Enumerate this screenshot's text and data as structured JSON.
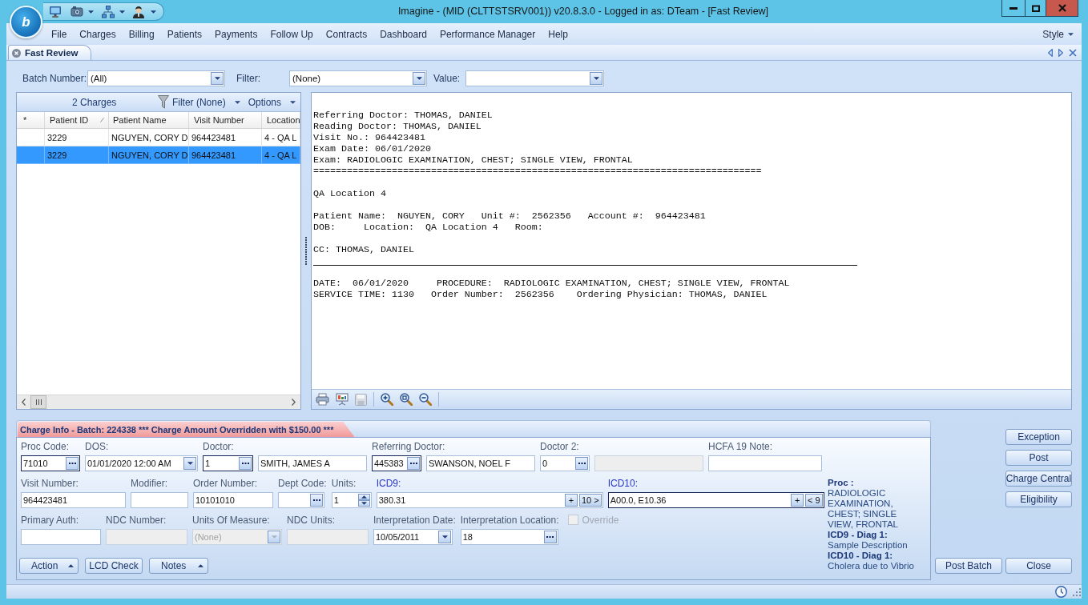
{
  "window": {
    "app_button": "b",
    "title": "Imagine - (MID (CLTTSTSRV001)) v20.8.3.0 - Logged in as: DTeam - [Fast Review]"
  },
  "menu": {
    "items": [
      "File",
      "Charges",
      "Billing",
      "Patients",
      "Payments",
      "Follow Up",
      "Contracts",
      "Dashboard",
      "Performance Manager",
      "Help"
    ],
    "style": "Style"
  },
  "tabs": [
    {
      "label": "Fast Review",
      "selected": true
    }
  ],
  "filters": [
    {
      "label": "Batch Number:",
      "value": "(All)"
    },
    {
      "label": "Filter:",
      "value": "(None)"
    },
    {
      "label": "Value:"
    }
  ],
  "charges_grid": {
    "count": "2 Charges",
    "filter": "Filter (None)",
    "options": "Options",
    "columns": [
      {
        "label": "*",
        "sorted": false
      },
      {
        "label": "Patient ID",
        "sorted": true
      },
      {
        "label": "Patient Name",
        "sorted": false
      },
      {
        "label": "Visit Number",
        "sorted": false
      },
      {
        "label": "Location",
        "sorted": false
      }
    ],
    "rows": [
      {
        "selected": false,
        "cells": [
          "",
          "3229",
          "NGUYEN, CORY D",
          "964423481",
          "4 - QA L"
        ]
      },
      {
        "selected": true,
        "cells": [
          "",
          "3229",
          "NGUYEN, CORY D",
          "964423481",
          "4 - QA L"
        ]
      }
    ]
  },
  "document": {
    "blocks": [
      {
        "kind": "text",
        "lines": [
          "Referring Doctor: THOMAS, DANIEL",
          "Reading Doctor: THOMAS, DANIEL",
          "Visit No.: 964423481",
          "Exam Date: 06/01/2020",
          "Exam: RADIOLOGIC EXAMINATION, CHEST; SINGLE VIEW, FRONTAL",
          "================================================================================"
        ]
      },
      {
        "kind": "text",
        "lines": [
          "QA Location 4"
        ]
      },
      {
        "kind": "text",
        "lines": [
          "Patient Name:  NGUYEN, CORY   Unit #:  2562356   Account #:  964423481",
          "DOB:     Location:  QA Location 4   Room:"
        ]
      },
      {
        "kind": "text",
        "lines": [
          "CC: THOMAS, DANIEL"
        ]
      },
      {
        "kind": "rule"
      },
      {
        "kind": "text",
        "lines": [
          "DATE:  06/01/2020     PROCEDURE:  RADIOLOGIC EXAMINATION, CHEST; SINGLE VIEW, FRONTAL",
          "SERVICE TIME: 1130   Order Number:  2562356    Ordering Physician: THOMAS, DANIEL"
        ]
      }
    ]
  },
  "charge_info": {
    "title": "Charge Info - Batch: 224338 *** Charge Amount Overridden with $150.00 ***",
    "warning": true,
    "rows": [
      {
        "fields": [
          {
            "label": "Proc Code:",
            "kind": "lookup",
            "value": "71010",
            "required": true,
            "disabled": false
          },
          {
            "label": "DOS:",
            "kind": "combo",
            "value": "01/01/2020 12:00 AM",
            "required": false,
            "disabled": false
          },
          {
            "label": "Doctor:",
            "kind": "lookup",
            "value": "1",
            "required": true,
            "disabled": false,
            "description": {
              "value": "SMITH, JAMES A",
              "disabled": false
            }
          },
          {
            "label": "Referring Doctor:",
            "kind": "lookup",
            "value": "445383",
            "required": true,
            "disabled": false,
            "description": {
              "value": "SWANSON, NOEL F",
              "disabled": false
            }
          },
          {
            "label": "Doctor 2:",
            "kind": "lookup",
            "value": "0",
            "required": false,
            "disabled": false,
            "description": {
              "disabled": true
            }
          },
          {
            "label": "HCFA 19 Note:",
            "kind": "text",
            "required": false,
            "disabled": false
          }
        ]
      },
      {
        "fields": [
          {
            "label": "Visit Number:",
            "kind": "text",
            "value": "964423481",
            "required": false,
            "disabled": false
          },
          {
            "label": "Modifier:",
            "kind": "text",
            "required": false,
            "disabled": false
          },
          {
            "label": "Order Number:",
            "kind": "text",
            "value": "10101010",
            "required": false,
            "disabled": false
          },
          {
            "label": "Dept Code:",
            "kind": "lookup",
            "required": false,
            "disabled": false
          },
          {
            "label": "Units:",
            "kind": "spin",
            "value": "1",
            "required": false,
            "disabled": false
          },
          {
            "label": "ICD9:",
            "kind": "codes",
            "value": "380.31",
            "add": "+",
            "toggle": "10 >",
            "required": false,
            "disabled": false
          },
          {
            "label": "ICD10:",
            "kind": "codes",
            "value": "A00.0, E10.36",
            "add": "+",
            "toggle": "< 9",
            "required": true,
            "disabled": false
          }
        ]
      },
      {
        "fields": [
          {
            "label": "Primary Auth:",
            "kind": "text",
            "required": false,
            "disabled": false
          },
          {
            "label": "NDC Number:",
            "kind": "text",
            "required": false,
            "disabled": true
          },
          {
            "label": "Units Of Measure:",
            "kind": "combo",
            "value": "(None)",
            "required": false,
            "disabled": true
          },
          {
            "label": "NDC Units:",
            "kind": "text",
            "required": false,
            "disabled": true
          },
          {
            "label": "Interpretation Date:",
            "kind": "combo",
            "value": "10/05/2011",
            "required": false,
            "disabled": false
          },
          {
            "label": "Interpretation Location:",
            "kind": "lookup",
            "value": "18",
            "required": false,
            "disabled": false
          },
          {
            "label": "Override",
            "kind": "checkbox",
            "checked": false,
            "disabled": true
          }
        ]
      }
    ],
    "summary": [
      {
        "kind": "heading",
        "text": "Proc :"
      },
      {
        "kind": "text",
        "text": "RADIOLOGIC EXAMINATION, CHEST; SINGLE VIEW, FRONTAL"
      },
      {
        "kind": "heading",
        "text": "ICD9 - Diag 1:"
      },
      {
        "kind": "text",
        "text": "Sample Description"
      },
      {
        "kind": "heading",
        "text": "ICD10 - Diag 1:"
      },
      {
        "kind": "text",
        "text": "Cholera due to Vibrio"
      }
    ],
    "buttons": [
      {
        "label": "Action",
        "menu": true
      },
      {
        "label": "LCD Check",
        "menu": false
      },
      {
        "label": "Notes",
        "menu": true
      }
    ]
  },
  "side_buttons": [
    "Exception",
    "Post",
    "Charge Central",
    "Eligibility"
  ],
  "batch_buttons": [
    "Post Batch",
    "Close"
  ]
}
